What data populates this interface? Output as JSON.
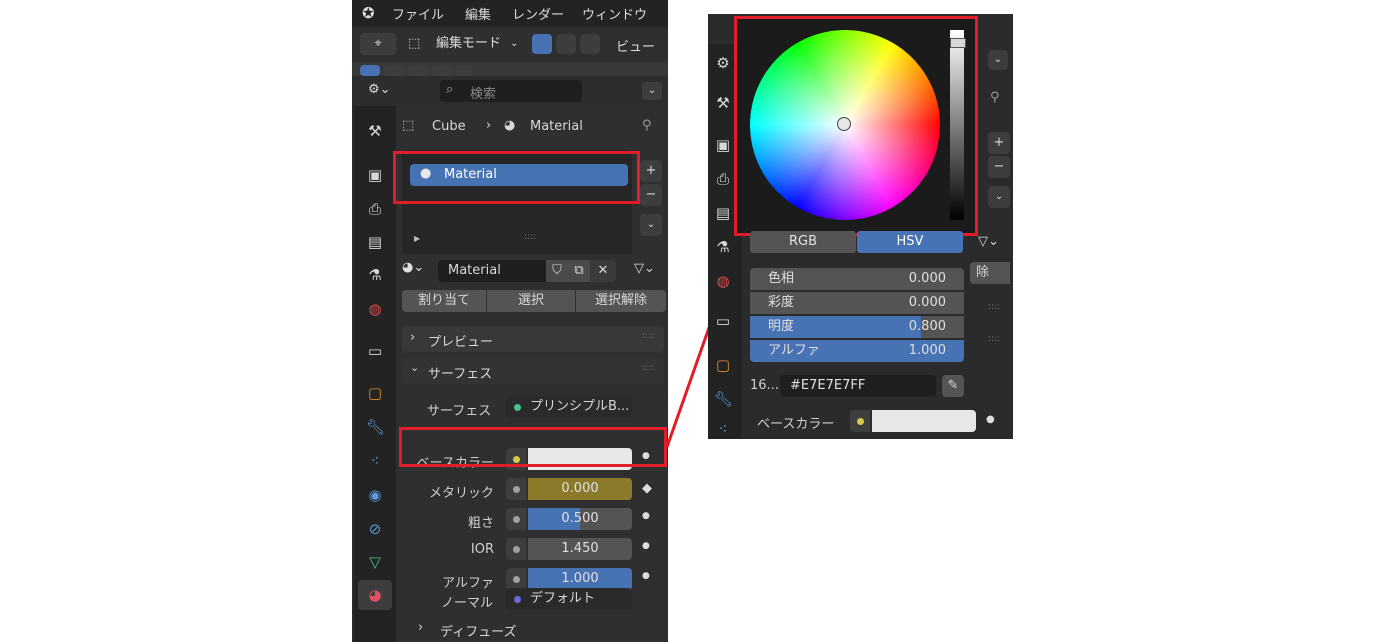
{
  "menu": [
    "ファイル",
    "編集",
    "レンダー",
    "ウィンドウ"
  ],
  "toolbar": {
    "mode_label": "編集モード",
    "view_label": "ビュー"
  },
  "search_placeholder": "検索",
  "breadcrumb": {
    "object": "Cube",
    "material": "Material"
  },
  "material_slot": {
    "name": "Material"
  },
  "material_selector": {
    "name": "Material"
  },
  "slot_buttons": [
    "割り当て",
    "選択",
    "選択解除"
  ],
  "sections": {
    "preview": "プレビュー",
    "surface": "サーフェス",
    "diffuse": "ディフューズ"
  },
  "surface_row": {
    "label": "サーフェス",
    "value": "プリンシプルB..."
  },
  "properties": [
    {
      "label": "ベースカラー",
      "value": "",
      "fill_fraction": 0,
      "fill_color": "#e8e8e8",
      "socket_color": "#d8c84a"
    },
    {
      "label": "メタリック",
      "value": "0.000",
      "fill_fraction": 1.0,
      "fill_color": "#8a7a2a",
      "socket_color": "#a0a0a0"
    },
    {
      "label": "粗さ",
      "value": "0.500",
      "fill_fraction": 0.5,
      "fill_color": "#4772b3",
      "socket_color": "#a0a0a0"
    },
    {
      "label": "IOR",
      "value": "1.450",
      "fill_fraction": 0,
      "fill_color": "#545454",
      "socket_color": "#a0a0a0"
    },
    {
      "label": "アルファ",
      "value": "1.000",
      "fill_fraction": 1.0,
      "fill_color": "#4772b3",
      "socket_color": "#a0a0a0"
    }
  ],
  "normal_row": {
    "label": "ノーマル",
    "value": "デフォルト"
  },
  "color_picker": {
    "tabs": [
      "RGB",
      "HSV"
    ],
    "active_tab": "HSV",
    "hsv": [
      {
        "label": "色相",
        "value": "0.000"
      },
      {
        "label": "彩度",
        "value": "0.000"
      },
      {
        "label": "明度",
        "value": "0.800"
      },
      {
        "label": "アルファ",
        "value": "1.000"
      }
    ],
    "hex_prefix": "16...",
    "hex_value": "#E7E7E7FF",
    "base_color_label": "ベースカラー",
    "deselect_fragment": "除"
  },
  "colors": {
    "accent": "#4772b3",
    "highlight": "#e11d2a",
    "panel": "#2b2b2b"
  }
}
